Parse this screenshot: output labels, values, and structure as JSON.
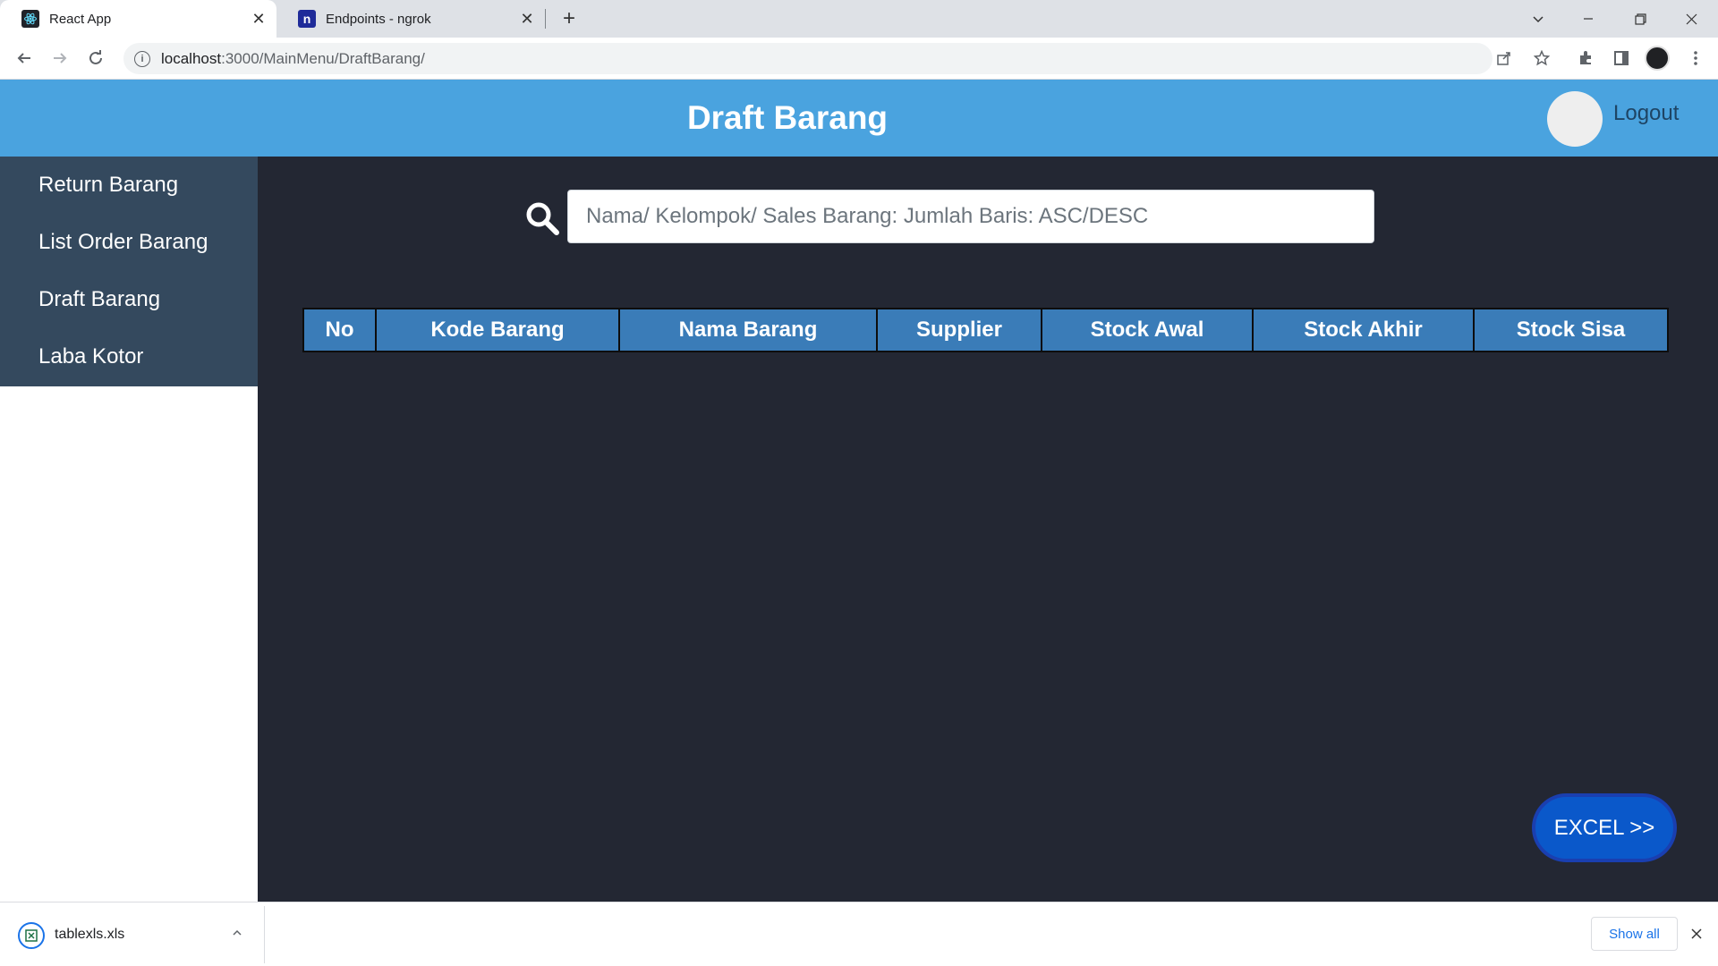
{
  "browser": {
    "tabs": [
      {
        "title": "React App",
        "icon": "react-icon"
      },
      {
        "title": "Endpoints - ngrok",
        "icon": "ngrok-icon",
        "icon_letter": "n"
      }
    ],
    "url_host": "localhost",
    "url_path": ":3000/MainMenu/DraftBarang/"
  },
  "header": {
    "title": "Draft Barang",
    "logout_label": "Logout",
    "color": "#4aa3df"
  },
  "sidebar": {
    "items": [
      {
        "label": "Return Barang"
      },
      {
        "label": "List Order Barang"
      },
      {
        "label": "Draft Barang"
      },
      {
        "label": "Laba Kotor"
      }
    ]
  },
  "search": {
    "placeholder": "Nama/ Kelompok/ Sales Barang: Jumlah Baris: ASC/DESC",
    "value": ""
  },
  "table": {
    "columns": [
      "No",
      "Kode Barang",
      "Nama Barang",
      "Supplier",
      "Stock Awal",
      "Stock Akhir",
      "Stock Sisa"
    ],
    "rows": [],
    "header_color": "#3a7cb8"
  },
  "excel_button": {
    "label": "EXCEL >>",
    "color": "#0a58ca"
  },
  "downloads": {
    "file_name": "tablexls.xls",
    "show_all_label": "Show all"
  }
}
